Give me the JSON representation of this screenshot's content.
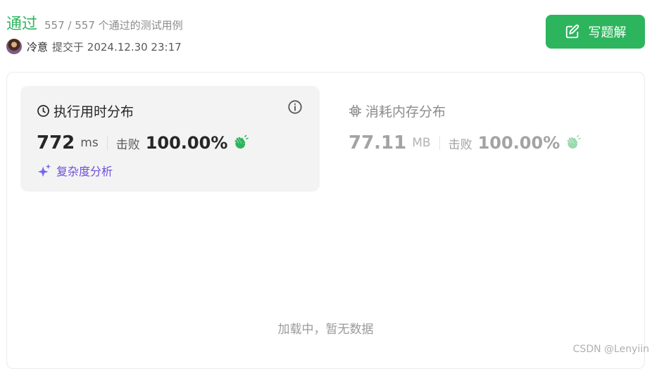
{
  "header": {
    "status": "通过",
    "testcases": "557 / 557 个通过的测试用例",
    "username": "冷意",
    "submitted": "提交于 2024.12.30 23:17"
  },
  "solution_button": {
    "label": "写题解",
    "icon": "edit-icon"
  },
  "runtime": {
    "title": "执行用时分布",
    "value": "772",
    "unit": "ms",
    "beats_label": "击败",
    "beats": "100.00%",
    "complexity_label": "复杂度分析"
  },
  "memory": {
    "title": "消耗内存分布",
    "value": "77.11",
    "unit": "MB",
    "beats_label": "击败",
    "beats": "100.00%"
  },
  "loading_text": "加载中，暂无数据",
  "watermark": "CSDN @Lenyiin",
  "colors": {
    "accent": "#2db55d",
    "ai_purple": "#6b4fd8"
  }
}
